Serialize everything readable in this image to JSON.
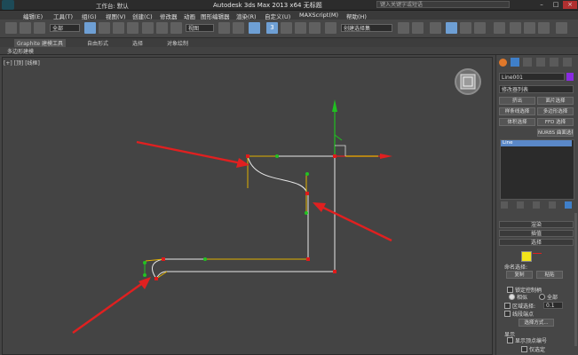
{
  "title_bar": {
    "app_title": "Autodesk 3ds Max  2013 x64    无标题",
    "workspace_label": "工作台: 默认",
    "search_placeholder": "键入关键字或短语"
  },
  "menu": [
    "编辑(E)",
    "工具(T)",
    "组(G)",
    "视图(V)",
    "创建(C)",
    "修改器",
    "动画",
    "图形编辑器",
    "渲染(R)",
    "自定义(U)",
    "MAXScript(M)",
    "帮助(H)"
  ],
  "toolbar": {
    "selection_filter": "全部",
    "ref_coord": "视图",
    "snap_label": "3",
    "named_selection": "创建选择集"
  },
  "ribbon": {
    "tabs": [
      "Graphite 建模工具",
      "自由形式",
      "选择",
      "对象绘制"
    ],
    "sub_label": "多边形建模"
  },
  "viewport": {
    "label": "[+] [顶] [线框]"
  },
  "command_panel": {
    "object_name": "Line001",
    "modifier_list": "修改器列表",
    "buttons": [
      "挤出",
      "面片选择",
      "样条线选择",
      "多边形选择",
      "体积选择",
      "FFD 选择",
      "NURBS 曲面选择"
    ],
    "stack_item": "Line",
    "rollouts": [
      "渲染",
      "插值",
      "选择"
    ],
    "named_selection_label": "命名选择:",
    "copy_btn": "复制",
    "paste_btn": "粘贴",
    "lock_handles": "锁定控制柄",
    "similar": "相似",
    "all": "全部",
    "area_select": "区域选择:",
    "area_value": "0.1",
    "segment_end": "线段端点",
    "select_by": "选择方式...",
    "display_label": "显示",
    "show_vertex_numbers": "显示顶点编号",
    "only_selected": "仅选定"
  },
  "colors": {
    "arrow": "#e02020",
    "vertex_red": "#e01a1a",
    "vertex_green": "#22c322",
    "spline": "#e8e8e8",
    "tangent": "#e0b000",
    "axis_x": "#e02020",
    "axis_y": "#20c020",
    "panel_bg": "#464646",
    "viewport_bg": "#444444"
  }
}
